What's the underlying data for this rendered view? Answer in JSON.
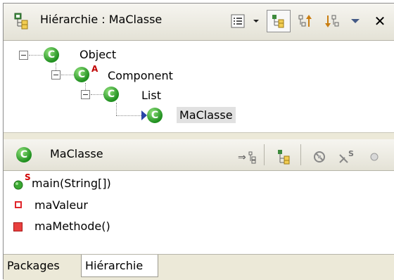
{
  "hierarchy_view": {
    "title": "Hiérarchie : MaClasse",
    "icons": {
      "title": "type-hierarchy-icon",
      "history": "history-list-icon",
      "history_dropdown": "dropdown-arrow-icon",
      "type_hierarchy": "type-hierarchy-view-icon",
      "supertype_hierarchy": "supertype-hierarchy-icon",
      "subtype_hierarchy": "subtype-hierarchy-icon",
      "view_menu": "view-menu-icon",
      "close": "close-icon"
    },
    "tree": [
      {
        "label": "Object",
        "badge": "C",
        "modifier": ""
      },
      {
        "label": "Component",
        "badge": "C",
        "modifier": "A"
      },
      {
        "label": "List",
        "badge": "C",
        "modifier": ""
      },
      {
        "label": "MaClasse",
        "badge": "C",
        "modifier": "",
        "selected": true
      }
    ]
  },
  "members_view": {
    "title": "MaClasse",
    "badge": "C",
    "icons": {
      "lock_view": "show-inherited-members-icon",
      "hierarchy_mode": "hierarchy-mode-icon",
      "hide_fields": "hide-fields-icon",
      "hide_static": "hide-static-members-icon",
      "hide_nonpublic": "hide-nonpublic-icon"
    },
    "members": [
      {
        "label": "main(String[])",
        "kind": "public-static-method",
        "modifier": "S",
        "color": "#3aa832"
      },
      {
        "label": "maValeur",
        "kind": "private-field",
        "modifier": "",
        "color": "#e0252b"
      },
      {
        "label": "maMethode()",
        "kind": "private-method",
        "modifier": "",
        "color": "#e0252b"
      }
    ]
  },
  "tabs": [
    {
      "label": "Packages",
      "active": false
    },
    {
      "label": "Hiérarchie",
      "active": true
    }
  ]
}
